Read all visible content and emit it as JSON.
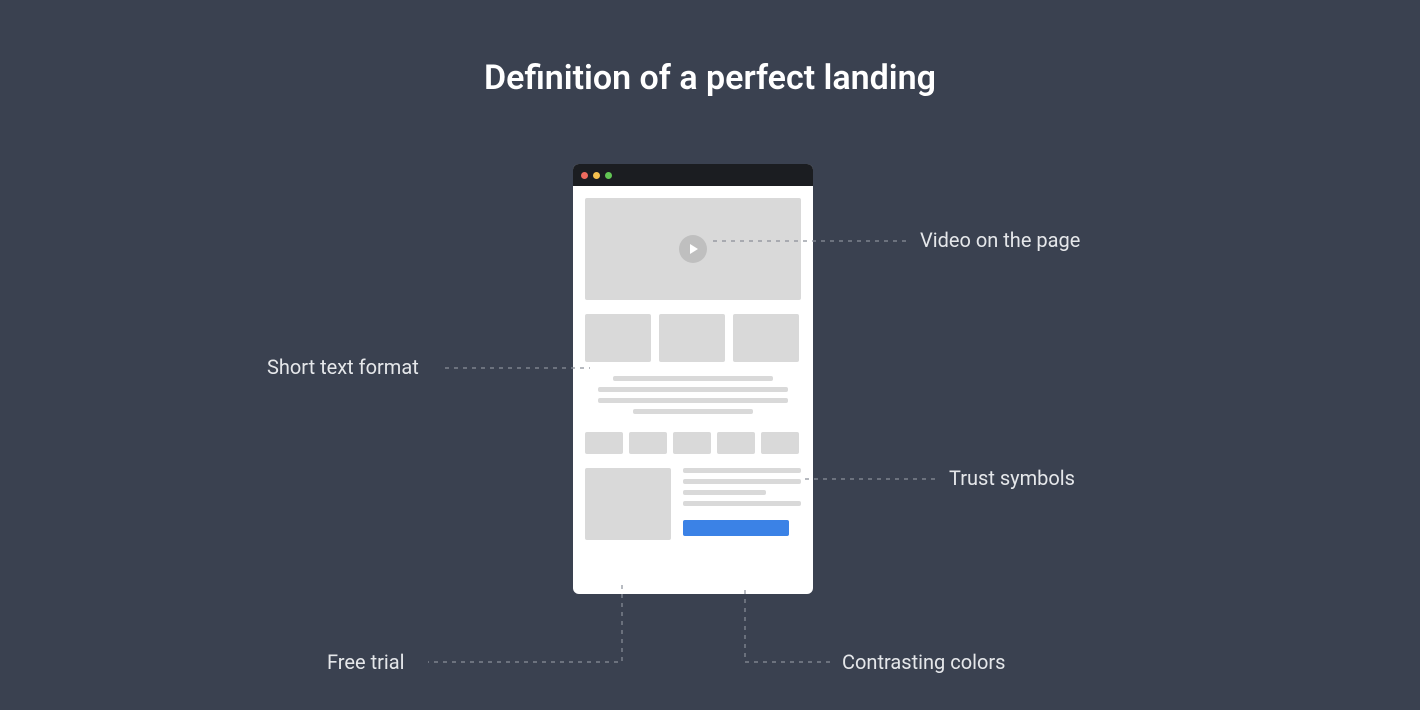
{
  "title": "Definition of a perfect landing",
  "callouts": {
    "video": "Video on the page",
    "short_text": "Short text format",
    "trust": "Trust symbols",
    "free_trial": "Free trial",
    "contrast": "Contrasting colors"
  }
}
